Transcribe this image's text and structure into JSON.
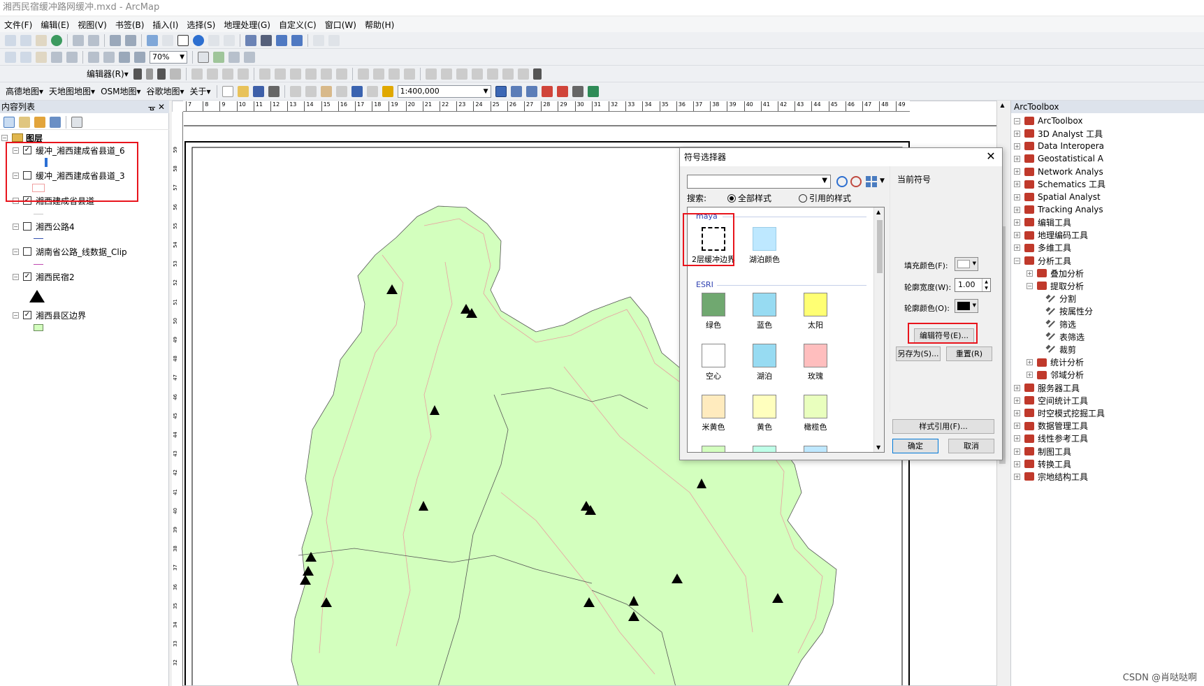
{
  "window": {
    "title": "湘西民宿缓冲路网缓冲.mxd - ArcMap"
  },
  "menu": [
    "文件(F)",
    "编辑(E)",
    "视图(V)",
    "书签(B)",
    "插入(I)",
    "选择(S)",
    "地理处理(G)",
    "自定义(C)",
    "窗口(W)",
    "帮助(H)"
  ],
  "toolbar": {
    "zoom": "70%",
    "editor_label": "编辑器(R)▾",
    "basemaps": [
      "高德地图▾",
      "天地图地图▾",
      "OSM地图▾",
      "谷歌地图▾",
      "关于▾"
    ],
    "scale": "1:400,000"
  },
  "toc": {
    "title": "内容列表",
    "root": "图层",
    "layers": [
      {
        "name": "缓冲_湘西建成省县道_6",
        "checked": true
      },
      {
        "name": "缓冲_湘西建成省县道_3",
        "checked": false
      },
      {
        "name": "湘西建成省县道",
        "checked": true
      },
      {
        "name": "湘西公路4",
        "checked": false
      },
      {
        "name": "湖南省公路_线数据_Clip",
        "checked": false
      },
      {
        "name": "湘西民宿2",
        "checked": true
      },
      {
        "name": "湘西县区边界",
        "checked": true
      }
    ]
  },
  "ruler": {
    "h_ticks": [
      "7",
      "8",
      "9",
      "10",
      "11",
      "12",
      "13",
      "14",
      "15",
      "16",
      "17",
      "18",
      "19",
      "20",
      "21",
      "22",
      "23",
      "24",
      "25",
      "26",
      "27",
      "28",
      "29",
      "30",
      "31",
      "32",
      "33",
      "34",
      "35",
      "36",
      "37",
      "38",
      "39",
      "40",
      "41",
      "42",
      "43",
      "44",
      "45",
      "46",
      "47",
      "48",
      "49"
    ],
    "v_ticks": [
      "59",
      "58",
      "57",
      "56",
      "55",
      "54",
      "53",
      "52",
      "51",
      "50",
      "49",
      "48",
      "47",
      "46",
      "45",
      "44",
      "43",
      "42",
      "41",
      "40",
      "39",
      "38",
      "37",
      "36",
      "35",
      "34",
      "33",
      "32"
    ]
  },
  "dialog": {
    "title": "符号选择器",
    "search_label": "搜索:",
    "radio_all": "全部样式",
    "radio_ref": "引用的样式",
    "group_maya": "maya",
    "group_esri": "ESRI",
    "symbols_maya": [
      {
        "name": "2层缓冲边界",
        "fill": "#ffffff",
        "dashed": true
      },
      {
        "name": "湖泊颜色",
        "fill": "#bee8ff",
        "dashed": false
      }
    ],
    "symbols_esri": [
      {
        "name": "绿色",
        "fill": "#70a870"
      },
      {
        "name": "蓝色",
        "fill": "#97dbf2"
      },
      {
        "name": "太阳",
        "fill": "#ffff73"
      },
      {
        "name": "空心",
        "fill": "#ffffff"
      },
      {
        "name": "湖泊",
        "fill": "#97dbf2"
      },
      {
        "name": "玫瑰",
        "fill": "#ffbebe"
      },
      {
        "name": "米黄色",
        "fill": "#ffebbe"
      },
      {
        "name": "黄色",
        "fill": "#ffffbe"
      },
      {
        "name": "橄榄色",
        "fill": "#e9ffbe"
      }
    ],
    "current_symbol_label": "当前符号",
    "fill_color_label": "填充颜色(F):",
    "outline_width_label": "轮廓宽度(W):",
    "outline_width_value": "1.00",
    "outline_color_label": "轮廓颜色(O):",
    "edit_symbol": "编辑符号(E)...",
    "save_as": "另存为(S)...",
    "reset": "重置(R)",
    "style_refs": "样式引用(F)...",
    "ok": "确定",
    "cancel": "取消"
  },
  "arctoolbox": {
    "title": "ArcToolbox",
    "root": "ArcToolbox",
    "items": [
      {
        "label": "3D Analyst 工具",
        "level": 1,
        "kind": "box",
        "exp": "+"
      },
      {
        "label": "Data Interopera",
        "level": 1,
        "kind": "box",
        "exp": "+"
      },
      {
        "label": "Geostatistical A",
        "level": 1,
        "kind": "box",
        "exp": "+"
      },
      {
        "label": "Network Analys",
        "level": 1,
        "kind": "box",
        "exp": "+"
      },
      {
        "label": "Schematics 工具",
        "level": 1,
        "kind": "box",
        "exp": "+"
      },
      {
        "label": "Spatial Analyst",
        "level": 1,
        "kind": "box",
        "exp": "+"
      },
      {
        "label": "Tracking Analys",
        "level": 1,
        "kind": "box",
        "exp": "+"
      },
      {
        "label": "编辑工具",
        "level": 1,
        "kind": "box",
        "exp": "+"
      },
      {
        "label": "地理编码工具",
        "level": 1,
        "kind": "box",
        "exp": "+"
      },
      {
        "label": "多维工具",
        "level": 1,
        "kind": "box",
        "exp": "+"
      },
      {
        "label": "分析工具",
        "level": 1,
        "kind": "box",
        "exp": "−"
      },
      {
        "label": "叠加分析",
        "level": 2,
        "kind": "box",
        "exp": "+"
      },
      {
        "label": "提取分析",
        "level": 2,
        "kind": "box",
        "exp": "−"
      },
      {
        "label": "分割",
        "level": 3,
        "kind": "tool",
        "exp": ""
      },
      {
        "label": "按属性分",
        "level": 3,
        "kind": "tool",
        "exp": ""
      },
      {
        "label": "筛选",
        "level": 3,
        "kind": "tool",
        "exp": ""
      },
      {
        "label": "表筛选",
        "level": 3,
        "kind": "tool",
        "exp": ""
      },
      {
        "label": "裁剪",
        "level": 3,
        "kind": "tool",
        "exp": ""
      },
      {
        "label": "统计分析",
        "level": 2,
        "kind": "box",
        "exp": "+"
      },
      {
        "label": "邻域分析",
        "level": 2,
        "kind": "box",
        "exp": "+"
      },
      {
        "label": "服务器工具",
        "level": 1,
        "kind": "box",
        "exp": "+"
      },
      {
        "label": "空间统计工具",
        "level": 1,
        "kind": "box",
        "exp": "+"
      },
      {
        "label": "时空模式挖掘工具",
        "level": 1,
        "kind": "box",
        "exp": "+"
      },
      {
        "label": "数据管理工具",
        "level": 1,
        "kind": "box",
        "exp": "+"
      },
      {
        "label": "线性参考工具",
        "level": 1,
        "kind": "box",
        "exp": "+"
      },
      {
        "label": "制图工具",
        "level": 1,
        "kind": "box",
        "exp": "+"
      },
      {
        "label": "转换工具",
        "level": 1,
        "kind": "box",
        "exp": "+"
      },
      {
        "label": "宗地结构工具",
        "level": 1,
        "kind": "box",
        "exp": "+"
      }
    ]
  },
  "watermark": "CSDN @肖哒哒啊",
  "colors": {
    "map_fill": "#d3ffbe",
    "highlight_red": "#e8141c",
    "selection_blue": "#0078d7"
  }
}
